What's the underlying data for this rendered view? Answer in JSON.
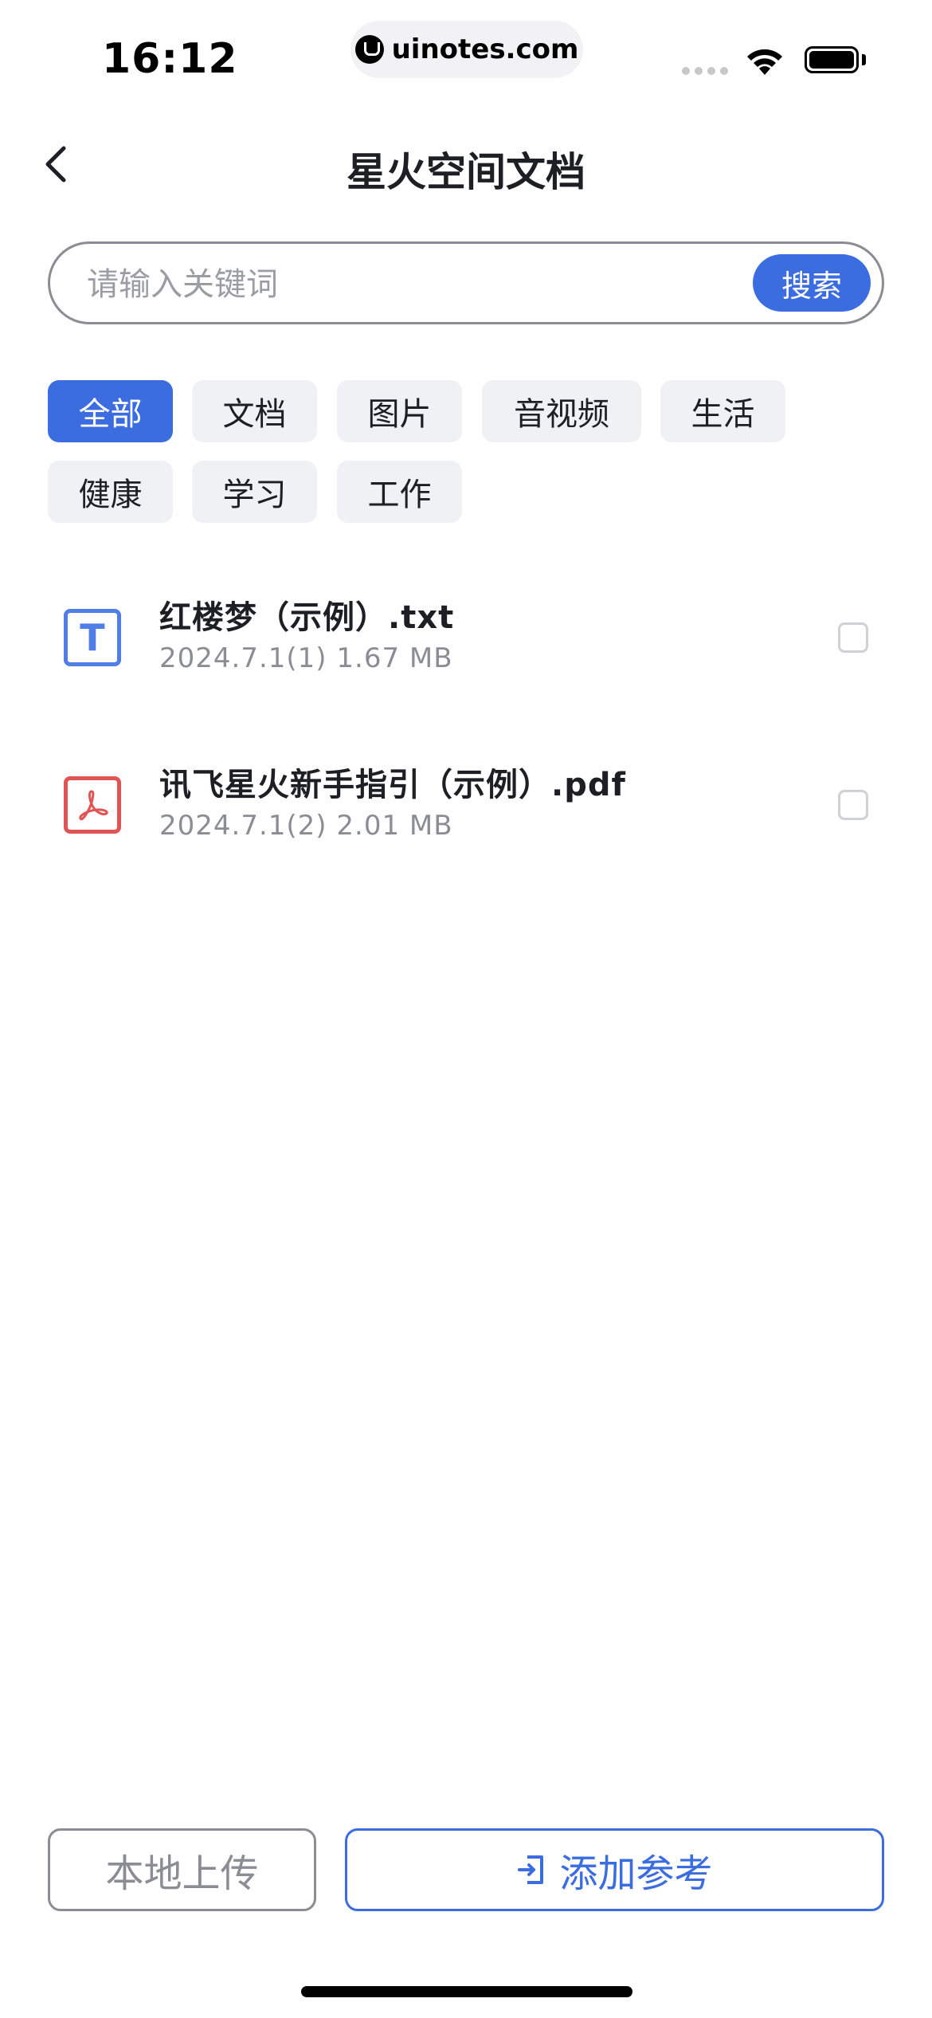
{
  "status_bar": {
    "time": "16:12",
    "url": "uinotes.com"
  },
  "header": {
    "title": "星火空间文档"
  },
  "search": {
    "placeholder": "请输入关键词",
    "button_label": "搜索"
  },
  "filters": [
    {
      "label": "全部",
      "active": true
    },
    {
      "label": "文档",
      "active": false
    },
    {
      "label": "图片",
      "active": false
    },
    {
      "label": "音视频",
      "active": false
    },
    {
      "label": "生活",
      "active": false
    },
    {
      "label": "健康",
      "active": false
    },
    {
      "label": "学习",
      "active": false
    },
    {
      "label": "工作",
      "active": false
    }
  ],
  "files": [
    {
      "name": "红楼梦（示例）.txt",
      "meta": "2024.7.1(1) 1.67 MB",
      "icon": "txt-file-icon",
      "icon_letter": "T",
      "checked": false
    },
    {
      "name": "讯飞星火新手指引（示例）.pdf",
      "meta": "2024.7.1(2) 2.01 MB",
      "icon": "pdf-file-icon",
      "checked": false
    }
  ],
  "footer": {
    "upload_label": "本地上传",
    "add_label": "添加参考"
  },
  "colors": {
    "accent": "#3b6ce0",
    "pdf_red": "#e05454",
    "txt_blue": "#4e7ee6"
  }
}
